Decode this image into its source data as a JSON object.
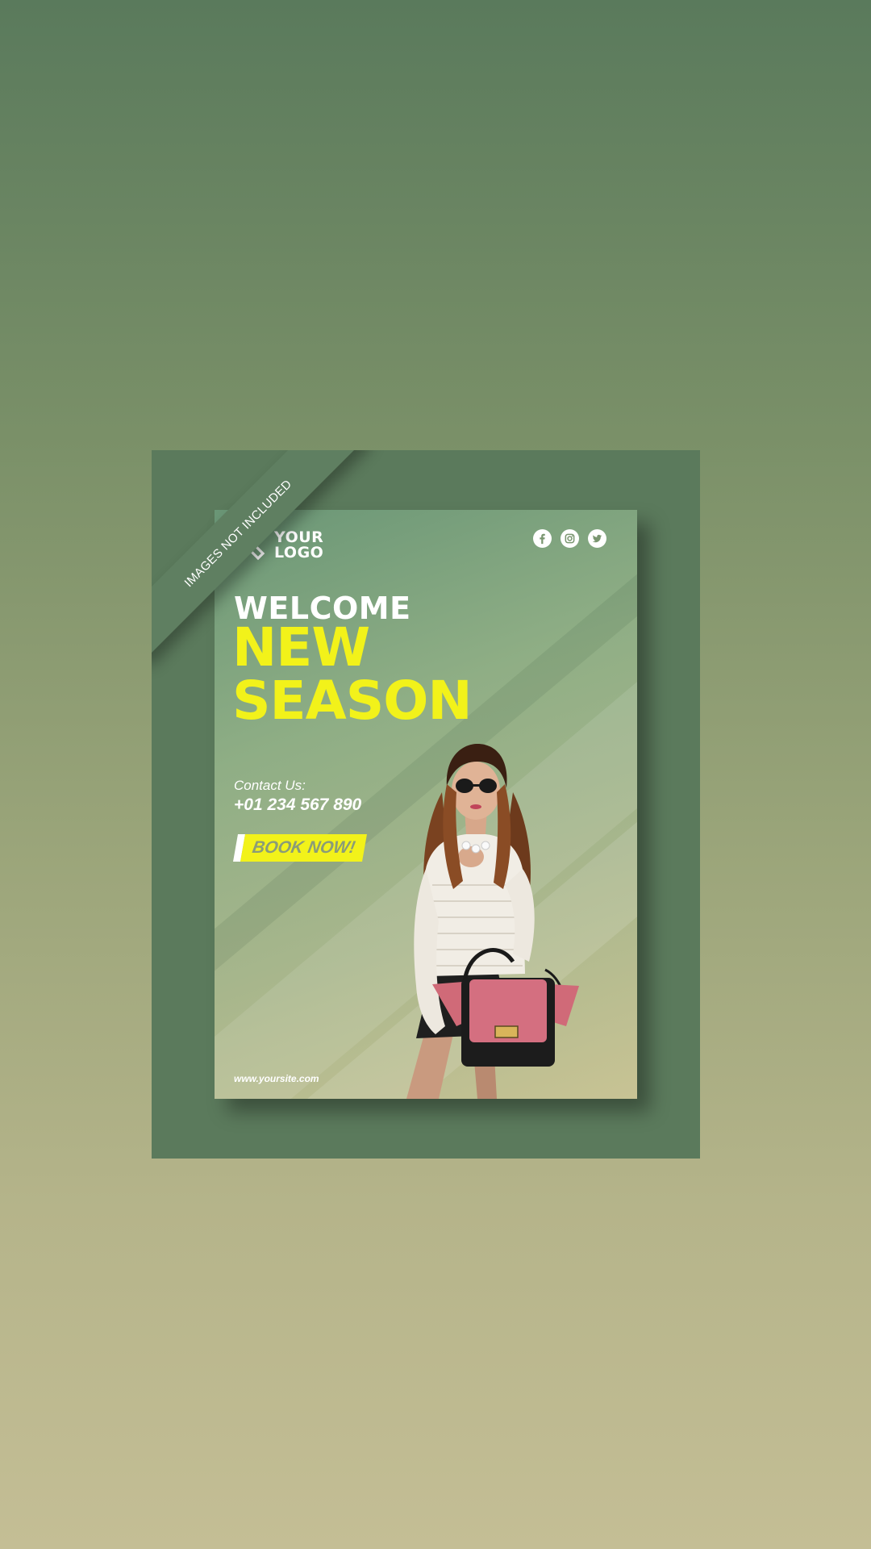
{
  "mockup": {
    "ribbon_text": "IMAGES NOT INCLUDED"
  },
  "poster": {
    "logo": {
      "line1": "YOUR",
      "line2": "LOGO",
      "icon": "x-logo-icon"
    },
    "social_icons": [
      "facebook-icon",
      "instagram-icon",
      "twitter-icon"
    ],
    "welcome": "WELCOME",
    "headline_line1": "NEW",
    "headline_line2": "SEASON",
    "contact_label": "Contact Us:",
    "contact_phone": "+01 234 567 890",
    "cta_label": "BOOK NOW!",
    "website": "www.yoursite.com"
  },
  "colors": {
    "background_top": "#5a7a5c",
    "background_bottom": "#c4be95",
    "board": "#5b7a5c",
    "headline_yellow": "#f2f21a",
    "text_white": "#ffffff"
  }
}
